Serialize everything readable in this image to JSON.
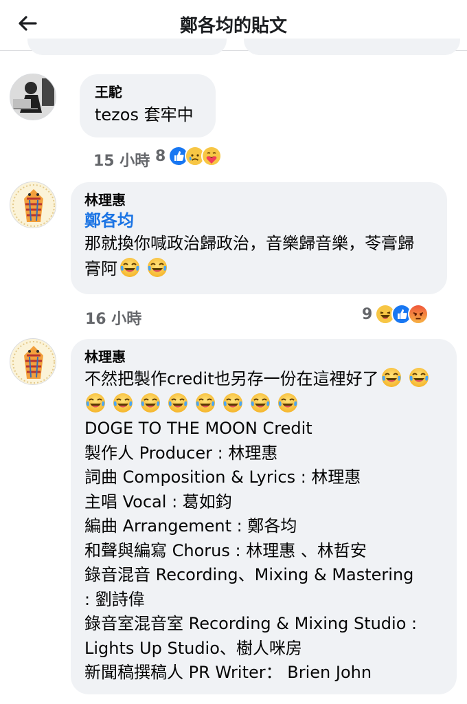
{
  "header": {
    "back_icon": "arrow-left-icon",
    "title": "鄭各均的貼文"
  },
  "comments": [
    {
      "author": "王駝",
      "lines": [
        "tezos 套牢中"
      ],
      "time": "15 小時",
      "reaction_count": "8",
      "reactions": [
        "like",
        "sad",
        "care"
      ]
    },
    {
      "author": "林理惠",
      "mention": "鄭各均",
      "lines": [
        "那就換你喊政治歸政治，音樂歸音樂，苓膏歸",
        "膏阿"
      ],
      "time": "16 小時",
      "reaction_count": "9",
      "reactions": [
        "haha",
        "like",
        "angry"
      ]
    },
    {
      "author": "林理惠",
      "lines": [
        "不然把製作credit也另存一份在這裡好了",
        "",
        "DOGE TO THE MOON Credit",
        "製作人 Producer : 林理惠",
        "詞曲 Composition & Lyrics  : 林理惠",
        "主唱 Vocal : 葛如鈞",
        "編曲 Arrangement : 鄭各均",
        "和聲與編寫 Chorus : 林理惠 、林哲安",
        "錄音混音 Recording、Mixing & Mastering",
        ": 劉詩偉",
        "錄音室混音室 Recording & Mixing  Studio :",
        "Lights Up Studio、樹人咪房",
        "新聞稿撰稿人 PR Writer：  Brien John"
      ]
    }
  ],
  "colors": {
    "link": "#1b74e4",
    "bubble": "#f0f2f5",
    "meta": "#65676b"
  }
}
